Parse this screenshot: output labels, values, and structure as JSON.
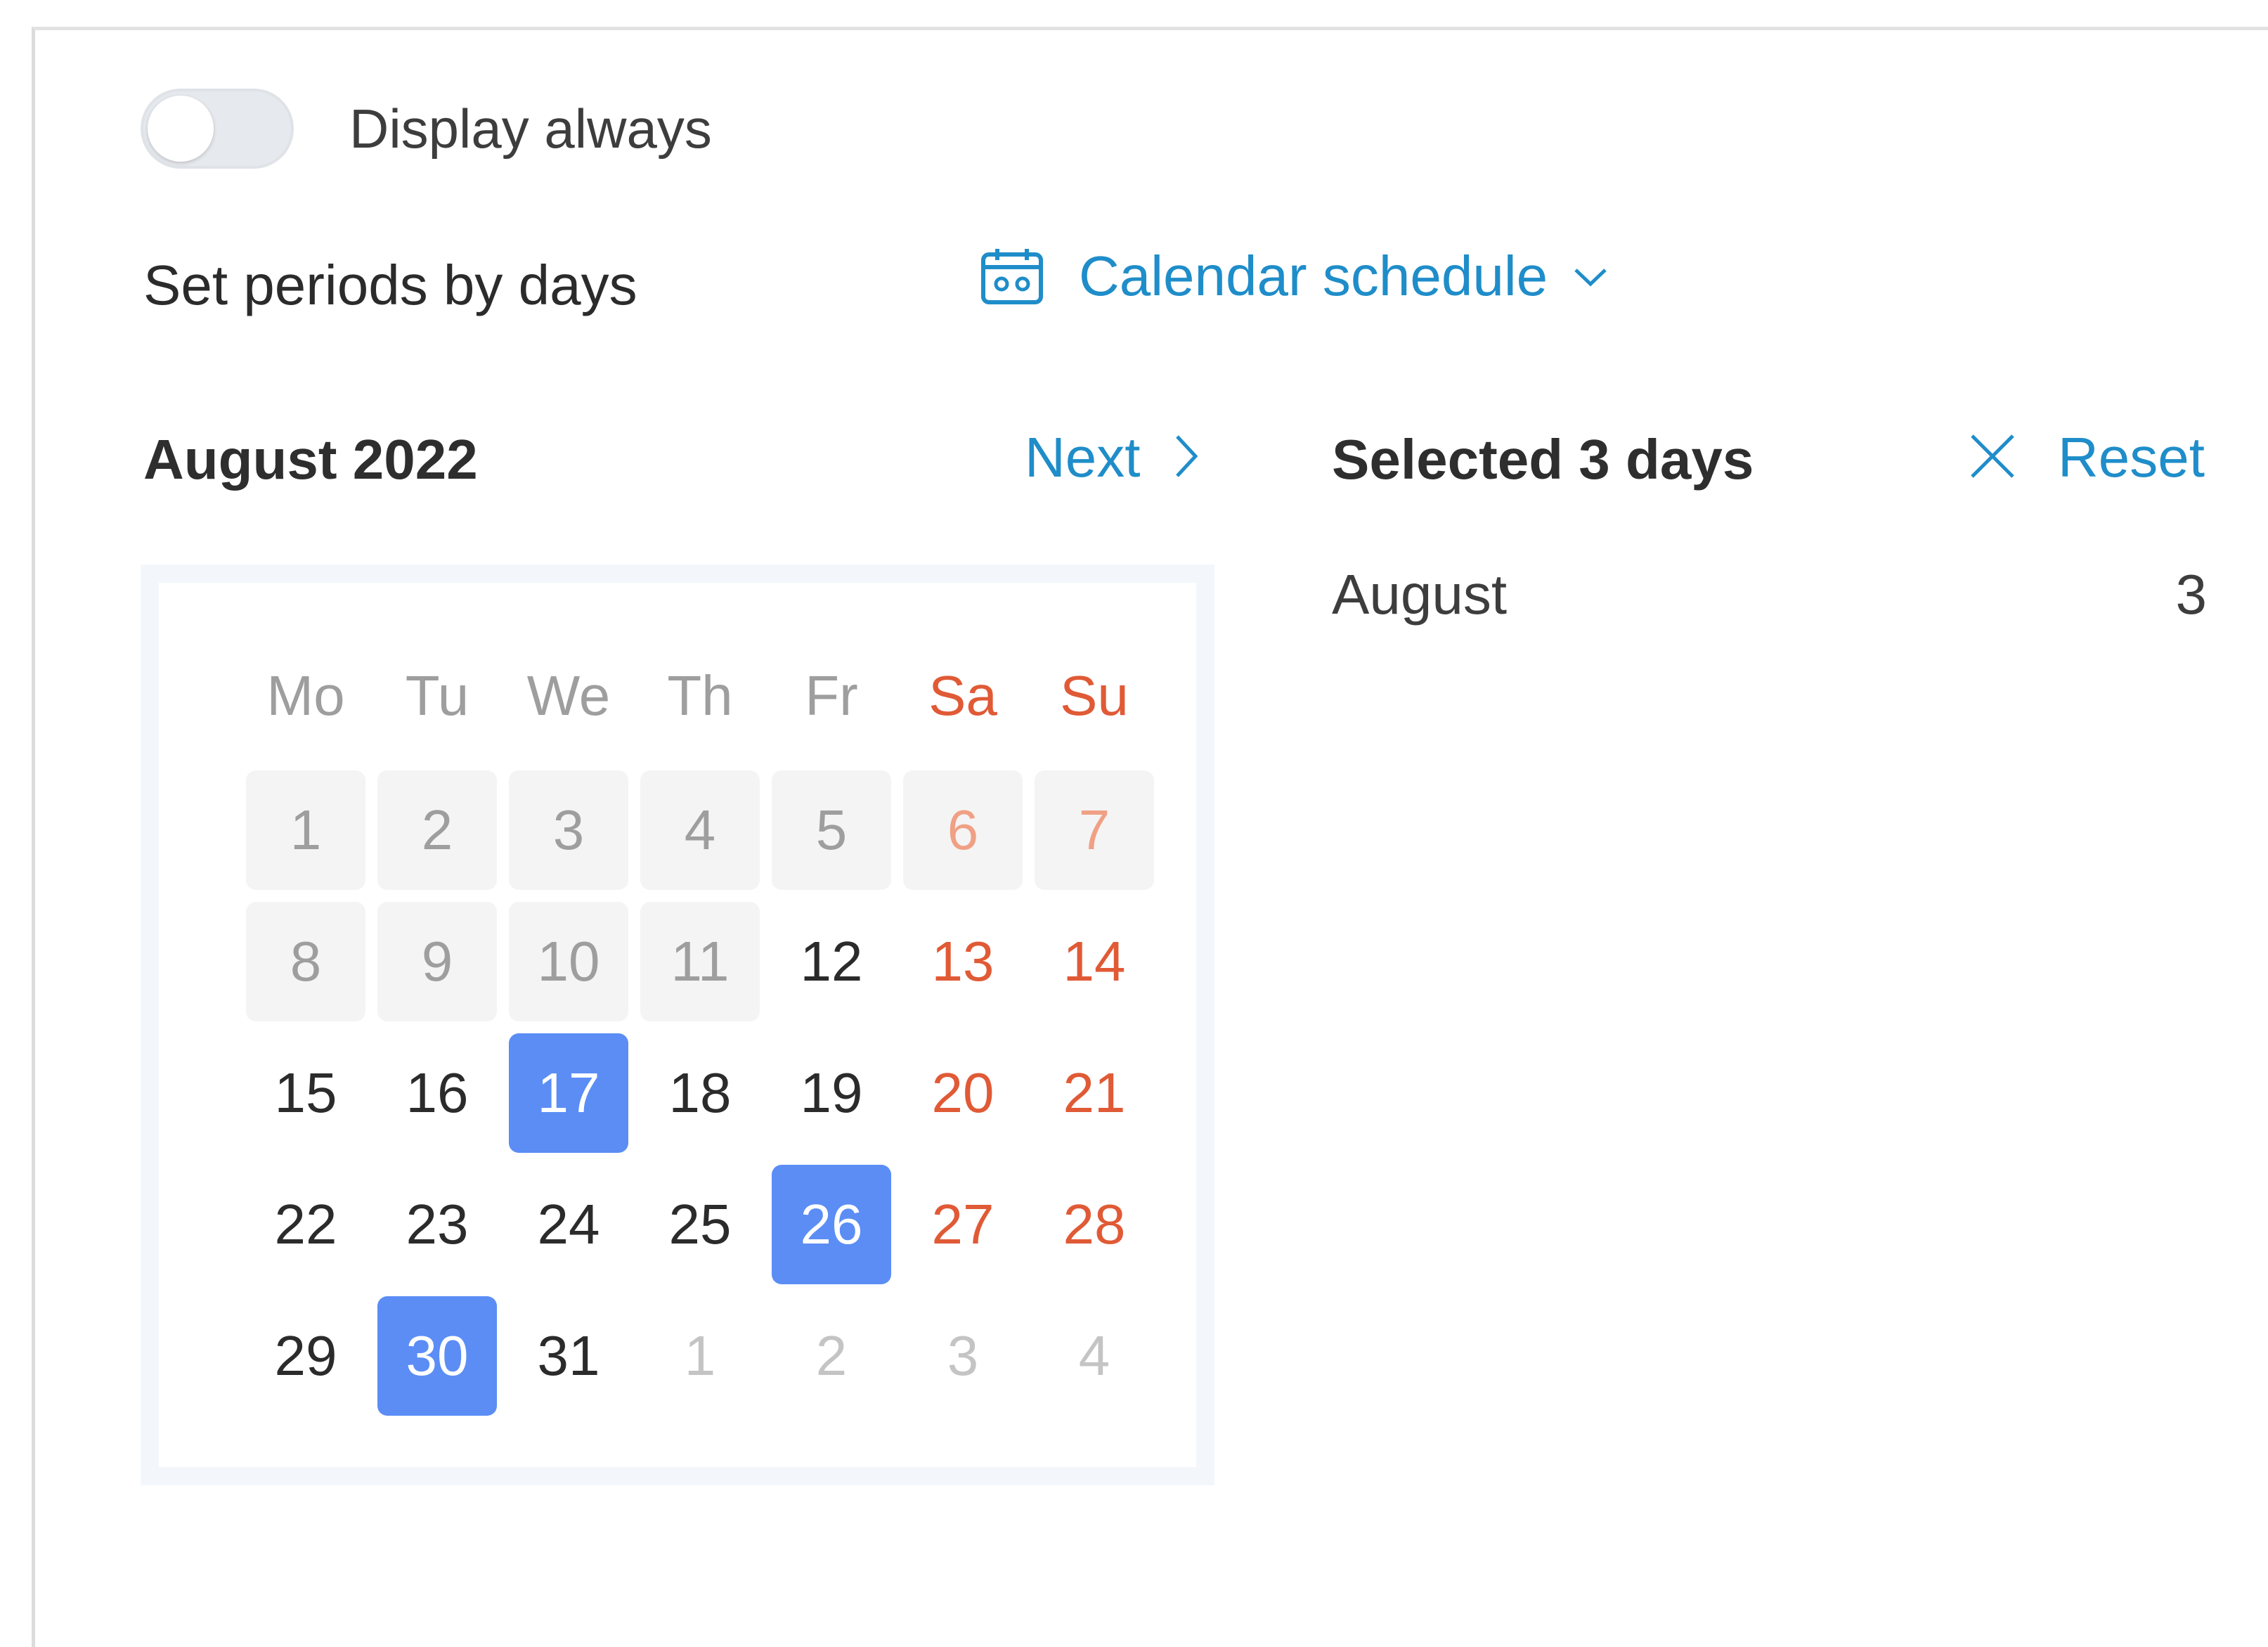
{
  "display_toggle": {
    "label": "Display always",
    "on": false
  },
  "periods": {
    "label": "Set periods by days",
    "schedule_dropdown": {
      "icon": "calendar-icon",
      "selected": "Calendar schedule"
    }
  },
  "calendar": {
    "month_title": "August 2022",
    "next_label": "Next",
    "weekdays": [
      {
        "label": "Mo",
        "weekend": false
      },
      {
        "label": "Tu",
        "weekend": false
      },
      {
        "label": "We",
        "weekend": false
      },
      {
        "label": "Th",
        "weekend": false
      },
      {
        "label": "Fr",
        "weekend": false
      },
      {
        "label": "Sa",
        "weekend": true
      },
      {
        "label": "Su",
        "weekend": true
      }
    ],
    "weeks": [
      [
        {
          "day": "1",
          "state": "past"
        },
        {
          "day": "2",
          "state": "past"
        },
        {
          "day": "3",
          "state": "past"
        },
        {
          "day": "4",
          "state": "past"
        },
        {
          "day": "5",
          "state": "past"
        },
        {
          "day": "6",
          "state": "past"
        },
        {
          "day": "7",
          "state": "past"
        }
      ],
      [
        {
          "day": "8",
          "state": "past"
        },
        {
          "day": "9",
          "state": "past"
        },
        {
          "day": "10",
          "state": "past"
        },
        {
          "day": "11",
          "state": "past"
        },
        {
          "day": "12",
          "state": "normal"
        },
        {
          "day": "13",
          "state": "normal"
        },
        {
          "day": "14",
          "state": "normal"
        }
      ],
      [
        {
          "day": "15",
          "state": "normal"
        },
        {
          "day": "16",
          "state": "normal"
        },
        {
          "day": "17",
          "state": "selected"
        },
        {
          "day": "18",
          "state": "normal"
        },
        {
          "day": "19",
          "state": "normal"
        },
        {
          "day": "20",
          "state": "normal"
        },
        {
          "day": "21",
          "state": "normal"
        }
      ],
      [
        {
          "day": "22",
          "state": "normal"
        },
        {
          "day": "23",
          "state": "normal"
        },
        {
          "day": "24",
          "state": "normal"
        },
        {
          "day": "25",
          "state": "normal"
        },
        {
          "day": "26",
          "state": "selected"
        },
        {
          "day": "27",
          "state": "normal"
        },
        {
          "day": "28",
          "state": "normal"
        }
      ],
      [
        {
          "day": "29",
          "state": "normal"
        },
        {
          "day": "30",
          "state": "selected"
        },
        {
          "day": "31",
          "state": "normal"
        },
        {
          "day": "1",
          "state": "outside"
        },
        {
          "day": "2",
          "state": "outside"
        },
        {
          "day": "3",
          "state": "outside"
        },
        {
          "day": "4",
          "state": "outside"
        }
      ]
    ]
  },
  "selection": {
    "title": "Selected 3 days",
    "reset_label": "Reset",
    "summary": [
      {
        "month": "August",
        "count": "3"
      }
    ]
  },
  "colors": {
    "accent": "#1f8dc9",
    "selected_day": "#5b8df5",
    "weekend": "#e05a36"
  }
}
